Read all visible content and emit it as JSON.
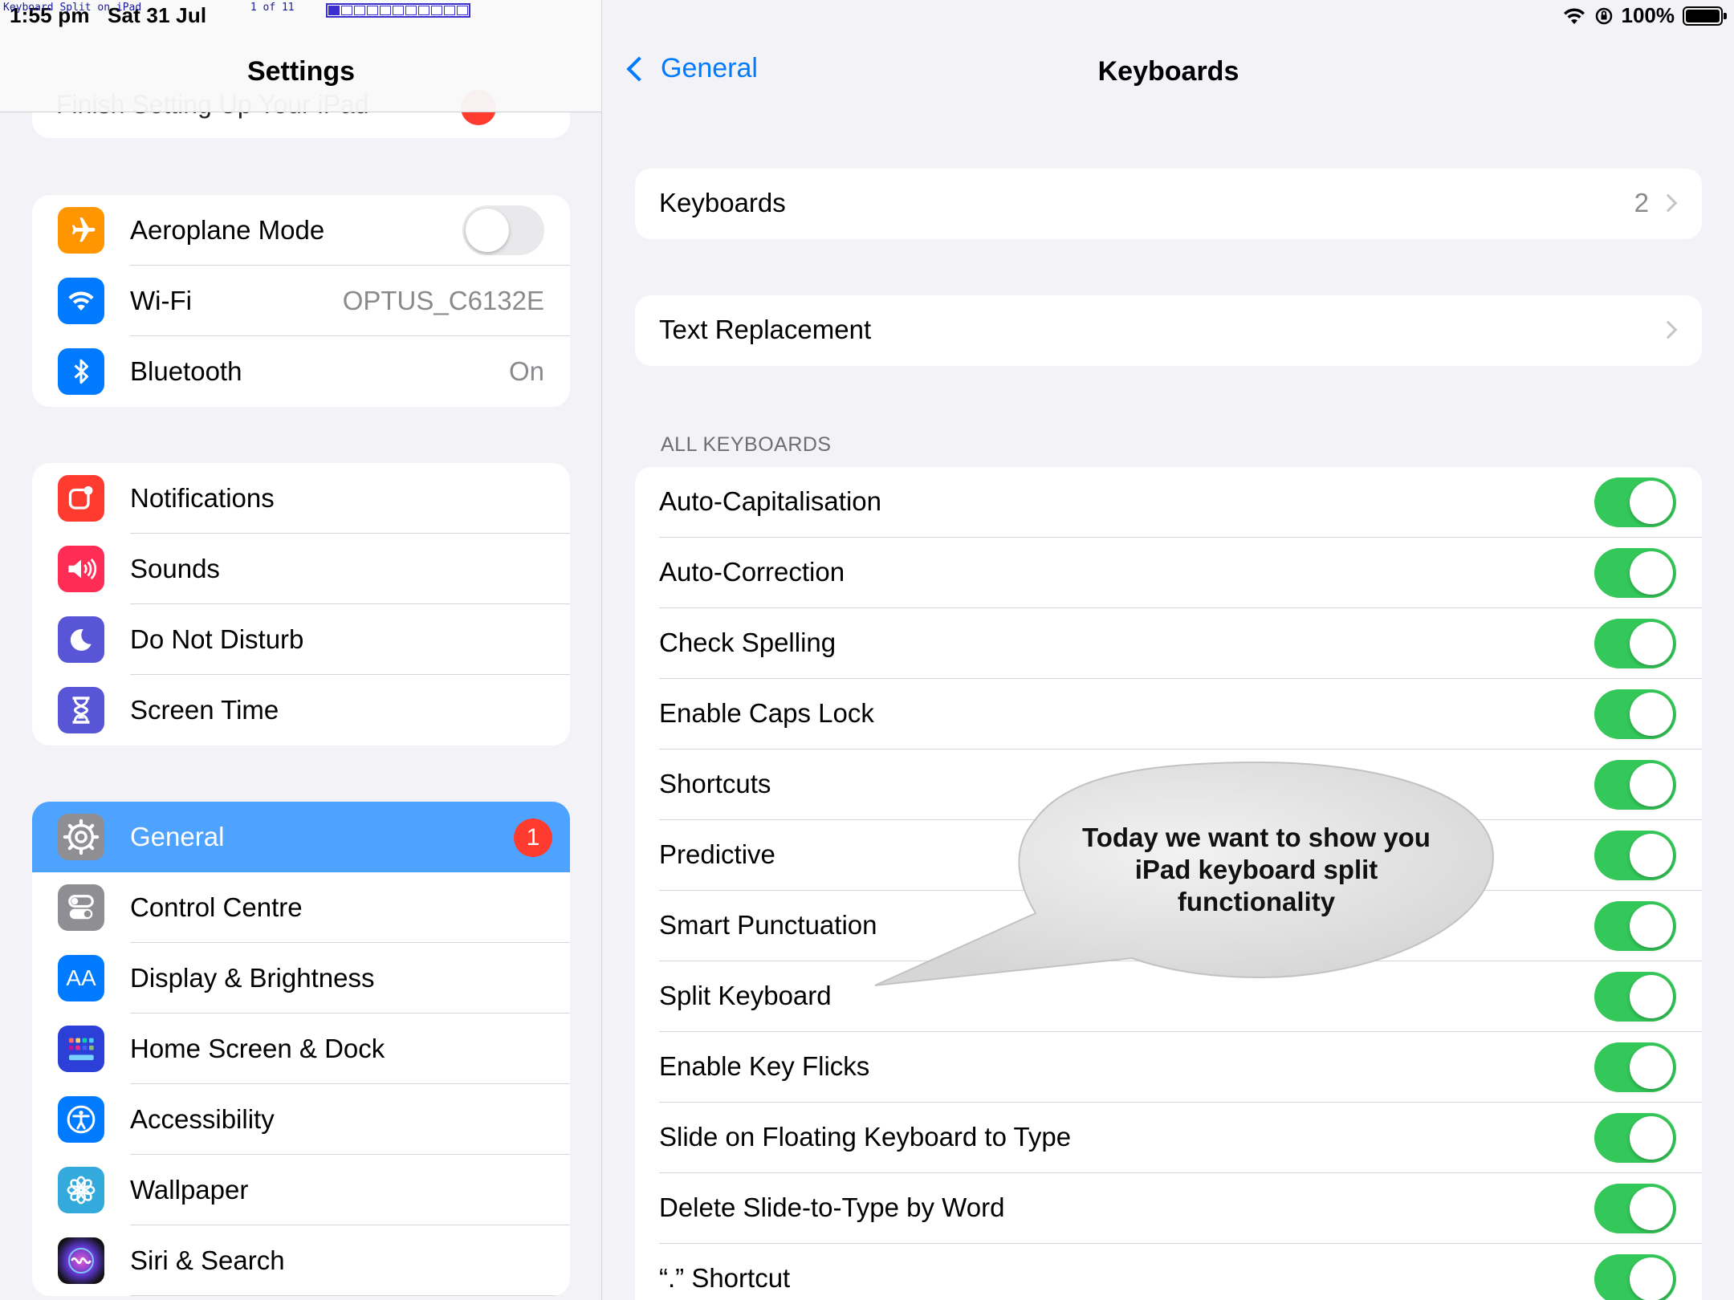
{
  "status_bar": {
    "time": "1:55 pm",
    "date": "Sat 31 Jul",
    "overlay_title": "Keyboard Split on iPad",
    "overlay_page": "1 of 11",
    "progress": {
      "current": 1,
      "total": 11
    },
    "battery": "100%"
  },
  "sidebar": {
    "title": "Settings",
    "peek_item": "Finish Setting Up Your iPad",
    "groups": [
      [
        {
          "label": "Aeroplane Mode",
          "icon": "airplane-icon",
          "color": "#ff9500",
          "toggle": false
        },
        {
          "label": "Wi-Fi",
          "icon": "wifi-icon",
          "color": "#007aff",
          "value": "OPTUS_C6132E"
        },
        {
          "label": "Bluetooth",
          "icon": "bluetooth-icon",
          "color": "#007aff",
          "value": "On"
        }
      ],
      [
        {
          "label": "Notifications",
          "icon": "notifications-icon",
          "color": "#ff3b30"
        },
        {
          "label": "Sounds",
          "icon": "speaker-icon",
          "color": "#ff2d55"
        },
        {
          "label": "Do Not Disturb",
          "icon": "moon-icon",
          "color": "#5856d6"
        },
        {
          "label": "Screen Time",
          "icon": "hourglass-icon",
          "color": "#5856d6"
        }
      ],
      [
        {
          "label": "General",
          "icon": "gear-icon",
          "color": "#8e8e93",
          "active": true,
          "badge": "1"
        },
        {
          "label": "Control Centre",
          "icon": "switches-icon",
          "color": "#8e8e93"
        },
        {
          "label": "Display & Brightness",
          "icon": "text-size-icon",
          "color": "#007aff"
        },
        {
          "label": "Home Screen & Dock",
          "icon": "home-grid-icon",
          "color": "#2c3fd6"
        },
        {
          "label": "Accessibility",
          "icon": "accessibility-icon",
          "color": "#007aff"
        },
        {
          "label": "Wallpaper",
          "icon": "flower-icon",
          "color": "#34aadc"
        },
        {
          "label": "Siri & Search",
          "icon": "siri-icon",
          "color": "#222222"
        }
      ]
    ]
  },
  "detail": {
    "back_label": "General",
    "title": "Keyboards",
    "keyboards_row": {
      "label": "Keyboards",
      "value": "2"
    },
    "text_replacement_row": {
      "label": "Text Replacement"
    },
    "section_header": "ALL KEYBOARDS",
    "toggles": [
      {
        "label": "Auto-Capitalisation",
        "on": true
      },
      {
        "label": "Auto-Correction",
        "on": true
      },
      {
        "label": "Check Spelling",
        "on": true
      },
      {
        "label": "Enable Caps Lock",
        "on": true
      },
      {
        "label": "Shortcuts",
        "on": true
      },
      {
        "label": "Predictive",
        "on": true
      },
      {
        "label": "Smart Punctuation",
        "on": true
      },
      {
        "label": "Split Keyboard",
        "on": true
      },
      {
        "label": "Enable Key Flicks",
        "on": true
      },
      {
        "label": "Slide on Floating Keyboard to Type",
        "on": true
      },
      {
        "label": "Delete Slide-to-Type by Word",
        "on": true
      },
      {
        "label": "“.” Shortcut",
        "on": true
      }
    ]
  },
  "callout": {
    "line1": "Today we want to show you",
    "line2": "iPad keyboard split",
    "line3": "functionality"
  },
  "colors": {
    "accent": "#007aff",
    "toggle_on": "#34c759",
    "active_row": "#4da3ff",
    "badge": "#ff3b30"
  }
}
